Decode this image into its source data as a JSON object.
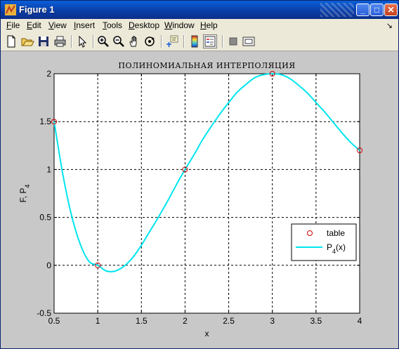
{
  "window": {
    "title": "Figure 1",
    "buttons": {
      "minimize": "_",
      "maximize": "□",
      "close": "✕"
    }
  },
  "menu": [
    {
      "u": "F",
      "rest": "ile"
    },
    {
      "u": "E",
      "rest": "dit"
    },
    {
      "u": "V",
      "rest": "iew"
    },
    {
      "u": "I",
      "rest": "nsert"
    },
    {
      "u": "T",
      "rest": "ools"
    },
    {
      "u": "D",
      "rest": "esktop"
    },
    {
      "u": "W",
      "rest": "indow"
    },
    {
      "u": "H",
      "rest": "elp"
    }
  ],
  "menu_arrow": "↘",
  "toolbar": [
    "new-figure-icon",
    "open-file-icon",
    "save-icon",
    "print-icon",
    "select-arrow-icon",
    "zoom-in-icon",
    "zoom-out-icon",
    "pan-hand-icon",
    "rotate-3d-icon",
    "data-cursor-icon",
    "colorbar-icon",
    "legend-icon",
    "hide-plot-tools-icon",
    "show-plot-tools-icon"
  ],
  "chart_data": {
    "type": "line",
    "title": "ПОЛИНОМИАЛЬНАЯ ИНТЕРПОЛЯЦИЯ",
    "xlabel": "x",
    "ylabel": "F, P",
    "ylabel_sub": "4",
    "xlim": [
      0.5,
      4
    ],
    "ylim": [
      -0.5,
      2
    ],
    "xticks": [
      "0.5",
      "1",
      "1.5",
      "2",
      "2.5",
      "3",
      "3.5",
      "4"
    ],
    "yticks": [
      "-0.5",
      "0",
      "0.5",
      "1",
      "1.5",
      "2"
    ],
    "grid": true,
    "legend_position": "right",
    "series": [
      {
        "name": "table",
        "style": "markers",
        "marker": "circle",
        "color": "#cc0000",
        "x": [
          0.5,
          1,
          2,
          3,
          4
        ],
        "y": [
          1.5,
          0,
          1,
          2,
          1.2
        ]
      },
      {
        "name": "P",
        "name_sub": "4",
        "name_suffix": "(x)",
        "style": "line",
        "color": "#00e5ee",
        "x": [
          0.5,
          0.6,
          0.7,
          0.8,
          0.9,
          1.0,
          1.1,
          1.2,
          1.3,
          1.4,
          1.5,
          1.6,
          1.7,
          1.8,
          1.9,
          2.0,
          2.1,
          2.2,
          2.3,
          2.4,
          2.5,
          2.6,
          2.7,
          2.8,
          2.9,
          3.0,
          3.1,
          3.2,
          3.3,
          3.4,
          3.5,
          3.6,
          3.7,
          3.8,
          3.9,
          4.0
        ],
        "y": [
          1.5,
          0.95,
          0.52,
          0.22,
          0.04,
          0.0,
          -0.06,
          -0.06,
          -0.01,
          0.08,
          0.21,
          0.36,
          0.51,
          0.67,
          0.84,
          1.0,
          1.15,
          1.31,
          1.45,
          1.58,
          1.7,
          1.81,
          1.89,
          1.96,
          1.99,
          2.0,
          1.99,
          1.95,
          1.88,
          1.8,
          1.7,
          1.6,
          1.49,
          1.38,
          1.28,
          1.2
        ]
      }
    ]
  },
  "colors": {
    "figure_bg": "#c8c8c8",
    "axes_bg": "#ffffff",
    "line": "#00e5ee",
    "marker": "#cc0000"
  }
}
